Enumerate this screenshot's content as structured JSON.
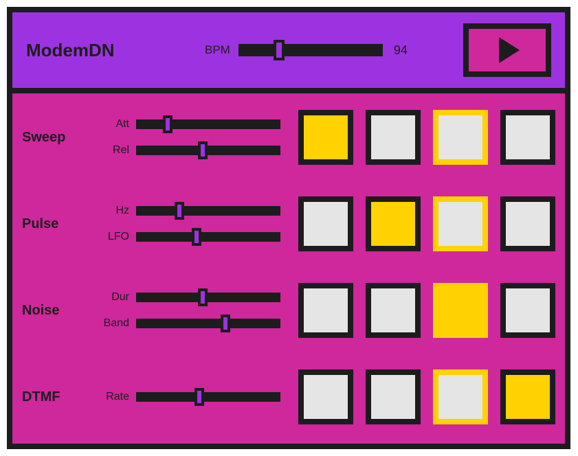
{
  "header": {
    "title": "ModemDN",
    "bpm_label": "BPM",
    "bpm_value": "94",
    "bpm_pos_pct": 28,
    "play_label": "Play"
  },
  "current_step": 2,
  "tracks": [
    {
      "name": "Sweep",
      "sliders": [
        {
          "label": "Att",
          "pos_pct": 22
        },
        {
          "label": "Rel",
          "pos_pct": 46
        }
      ],
      "steps": [
        true,
        false,
        false,
        false
      ]
    },
    {
      "name": "Pulse",
      "sliders": [
        {
          "label": "Hz",
          "pos_pct": 30
        },
        {
          "label": "LFO",
          "pos_pct": 42
        }
      ],
      "steps": [
        false,
        true,
        false,
        false
      ]
    },
    {
      "name": "Noise",
      "sliders": [
        {
          "label": "Dur",
          "pos_pct": 46
        },
        {
          "label": "Band",
          "pos_pct": 62
        }
      ],
      "steps": [
        false,
        false,
        true,
        false
      ]
    },
    {
      "name": "DTMF",
      "sliders": [
        {
          "label": "Rate",
          "pos_pct": 44
        }
      ],
      "steps": [
        false,
        false,
        false,
        true
      ]
    }
  ]
}
